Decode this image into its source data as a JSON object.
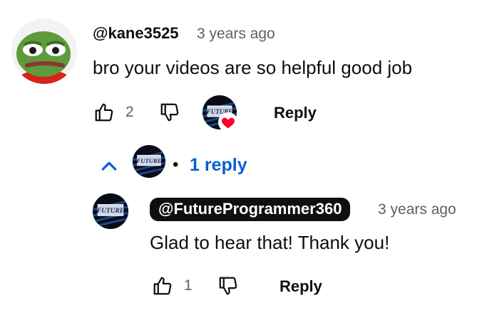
{
  "comment": {
    "handle": "@kane3525",
    "time": "3 years ago",
    "text": "bro your videos are so helpful good job",
    "likes": "2",
    "reply_label": "Reply"
  },
  "replies_toggle": {
    "dot": "•",
    "label": "1 reply"
  },
  "reply": {
    "handle": "@FutureProgrammer360",
    "time": "3 years ago",
    "text": "Glad to hear that! Thank you!",
    "likes": "1",
    "reply_label": "Reply"
  },
  "colors": {
    "link_blue": "#065fd4",
    "heart_red": "#ff0033",
    "secondary_text": "#606060"
  },
  "icons": [
    "like-icon",
    "dislike-icon",
    "chevron-up-icon",
    "heart-icon"
  ]
}
